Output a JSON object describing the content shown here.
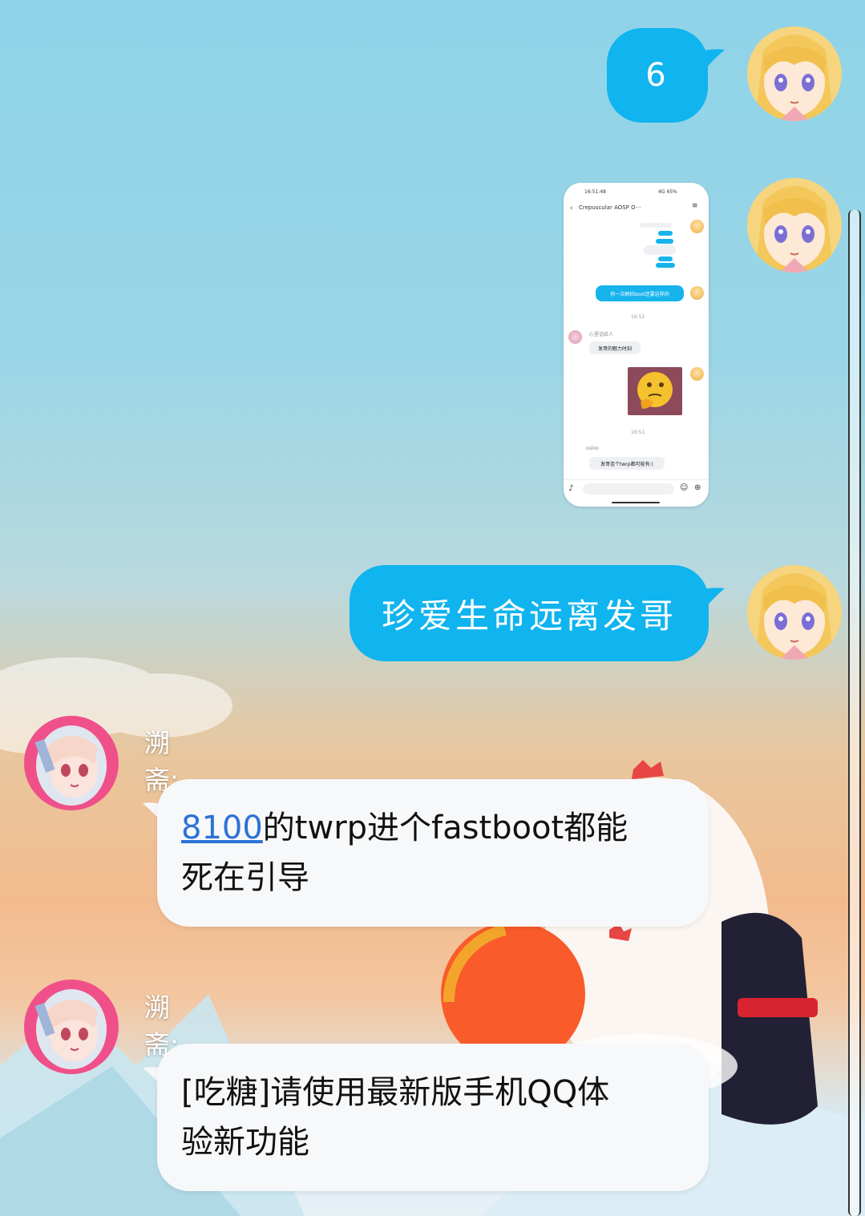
{
  "messages": {
    "m1": {
      "text": "6",
      "side": "out"
    },
    "m2": {
      "type": "image",
      "side": "out",
      "screenshot": {
        "time": "16:51:48",
        "status": "4G 45%",
        "chat_title": "Crepuscular AOSP O···",
        "bubble_1": "你一次刷机boot还要这样的",
        "timestamp_1": "16:51",
        "sender_1": "心里话给人",
        "reply_1": "发哥的魅力时刻",
        "timestamp_2": "16:51",
        "sender_2": "osloo",
        "reply_2": "发哥连个twrp都可能有:(",
        "emoji_face": "thinking-face"
      }
    },
    "m3": {
      "text": "珍爱生命远离发哥",
      "side": "out"
    },
    "m4": {
      "sender": "溯斋:",
      "link_text": "8100",
      "text_line1": "的twrp进个fastboot都能",
      "text_line2": "死在引导",
      "side": "in"
    },
    "m5": {
      "sender": "溯斋:",
      "text_line1": "[吃糖]请使用最新版手机QQ体",
      "text_line2": "验新功能",
      "side": "in"
    }
  },
  "colors": {
    "out_bubble": "#10b4ee",
    "in_bubble": "#f7f8fa",
    "link": "#2c72d6"
  }
}
